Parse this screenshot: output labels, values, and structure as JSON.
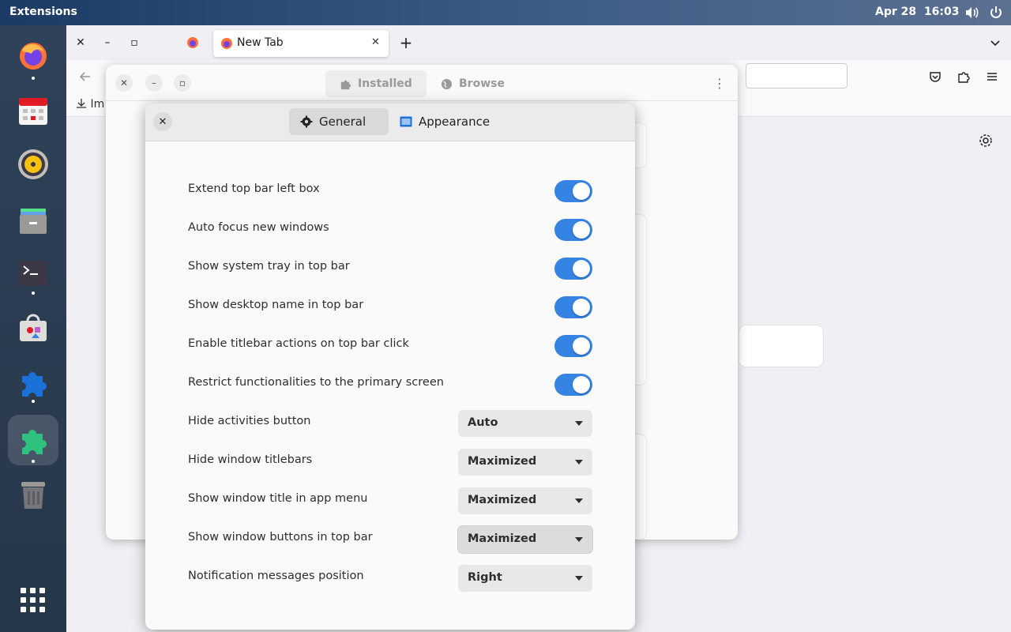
{
  "topbar": {
    "activities": "Extensions",
    "date": "Apr 28",
    "time": "16:03",
    "icons": [
      "volume-icon",
      "power-icon"
    ]
  },
  "dock": {
    "apps": [
      "firefox",
      "calendar",
      "rhythmbox",
      "files",
      "terminal",
      "software",
      "extensions",
      "extension-manager",
      "trash",
      "app-grid"
    ]
  },
  "firefox": {
    "tab_label": "New Tab",
    "bookmark_partial": "Im"
  },
  "extensions_window": {
    "tabs": [
      {
        "label": "Installed"
      },
      {
        "label": "Browse"
      }
    ]
  },
  "prefs": {
    "tabs": [
      {
        "label": "General",
        "icon": "gear-icon"
      },
      {
        "label": "Appearance",
        "icon": "appearance-icon"
      }
    ],
    "rows": [
      {
        "label": "Extend top bar left box",
        "type": "toggle",
        "on": true
      },
      {
        "label": "Auto focus new windows",
        "type": "toggle",
        "on": true
      },
      {
        "label": "Show system tray in top bar",
        "type": "toggle",
        "on": true
      },
      {
        "label": "Show desktop name in top bar",
        "type": "toggle",
        "on": true
      },
      {
        "label": "Enable titlebar actions on top bar click",
        "type": "toggle",
        "on": true
      },
      {
        "label": "Restrict functionalities to the primary screen",
        "type": "toggle",
        "on": true
      },
      {
        "label": "Hide activities button",
        "type": "dropdown",
        "value": "Auto"
      },
      {
        "label": "Hide window titlebars",
        "type": "dropdown",
        "value": "Maximized"
      },
      {
        "label": "Show window title in app menu",
        "type": "dropdown",
        "value": "Maximized"
      },
      {
        "label": "Show window buttons in top bar",
        "type": "dropdown",
        "value": "Maximized"
      },
      {
        "label": "Notification messages position",
        "type": "dropdown",
        "value": "Right"
      }
    ]
  },
  "colors": {
    "accent": "#3584e4",
    "topbar": "#1b3a64",
    "dock": "#2f4259"
  }
}
